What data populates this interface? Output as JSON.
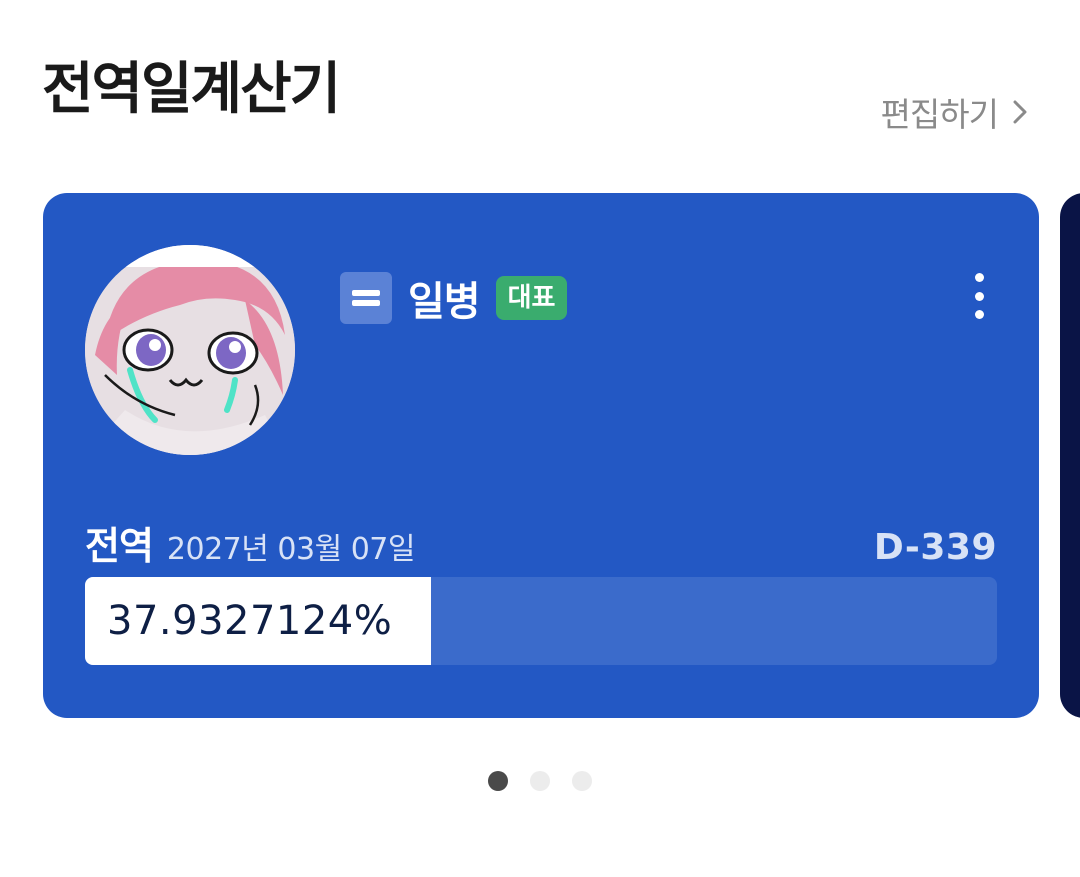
{
  "header": {
    "title": "전역일계산기",
    "edit_label": "편집하기"
  },
  "card": {
    "rank_label": "일병",
    "badge_label": "대표",
    "discharge_label": "전역",
    "discharge_date": "2027년 03월 07일",
    "dday": "D-339",
    "progress_text": "37.9327124%",
    "progress_fraction": 0.379327124
  },
  "carousel": {
    "page_count": 3,
    "active_index": 0
  },
  "colors": {
    "card_bg": "#2358c4",
    "badge_bg": "#3aac6e",
    "next_card_bg": "#0a1446"
  },
  "icons": {
    "edit": "chevron-right-icon",
    "rank": "rank-insignia-icon",
    "more": "more-vertical-icon"
  }
}
